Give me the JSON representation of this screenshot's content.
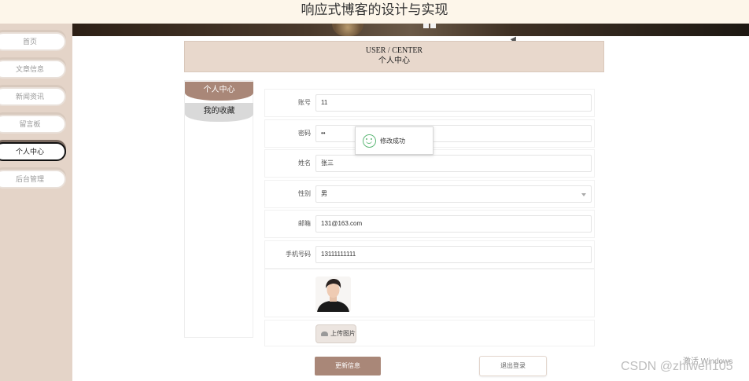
{
  "header": {
    "title": "响应式博客的设计与实现"
  },
  "sidebar": {
    "items": [
      {
        "label": "首页",
        "active": false
      },
      {
        "label": "文章信息",
        "active": false
      },
      {
        "label": "新闻资讯",
        "active": false
      },
      {
        "label": "留言板",
        "active": false
      },
      {
        "label": "个人中心",
        "active": true
      },
      {
        "label": "后台管理",
        "active": false
      }
    ]
  },
  "user_center": {
    "title_en": "USER / CENTER",
    "title_cn": "个人中心"
  },
  "tabs": [
    {
      "label": "个人中心",
      "active": true
    },
    {
      "label": "我的收藏",
      "active": false
    }
  ],
  "form": {
    "account": {
      "label": "账号",
      "value": "11"
    },
    "password": {
      "label": "密码",
      "value": "••"
    },
    "name": {
      "label": "姓名",
      "value": "张三"
    },
    "gender": {
      "label": "性别",
      "value": "男"
    },
    "email": {
      "label": "邮箱",
      "value": "131@163.com"
    },
    "phone": {
      "label": "手机号码",
      "value": "13111111111"
    },
    "upload_label": "上传图片",
    "update_label": "更新信息",
    "logout_label": "退出登录"
  },
  "toast": {
    "message": "修改成功",
    "icon": "smile-icon"
  },
  "watermarks": {
    "windows": "激活 Windows",
    "csdn": "CSDN @zhiwen105"
  },
  "colors": {
    "accent": "#a98778",
    "sidebar_bg": "#e4d4c8",
    "header_bg": "#fdf6ea",
    "toast_icon": "#5fb878"
  }
}
